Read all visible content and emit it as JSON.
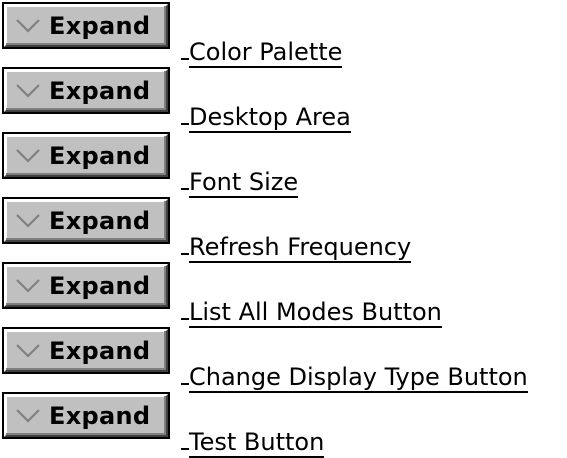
{
  "expand_button_label": "Expand",
  "topics": [
    {
      "label": "Color Palette"
    },
    {
      "label": "Desktop Area"
    },
    {
      "label": "Font Size"
    },
    {
      "label": "Refresh Frequency"
    },
    {
      "label": "List All Modes Button"
    },
    {
      "label": "Change Display Type Button"
    },
    {
      "label": "Test Button"
    }
  ],
  "icons": {
    "expand": "chevron-down-icon"
  },
  "colors": {
    "button_face": "#c0c0c0",
    "button_highlight": "#ffffff",
    "button_shadow": "#808080",
    "chevron": "#808080",
    "text": "#000000"
  }
}
